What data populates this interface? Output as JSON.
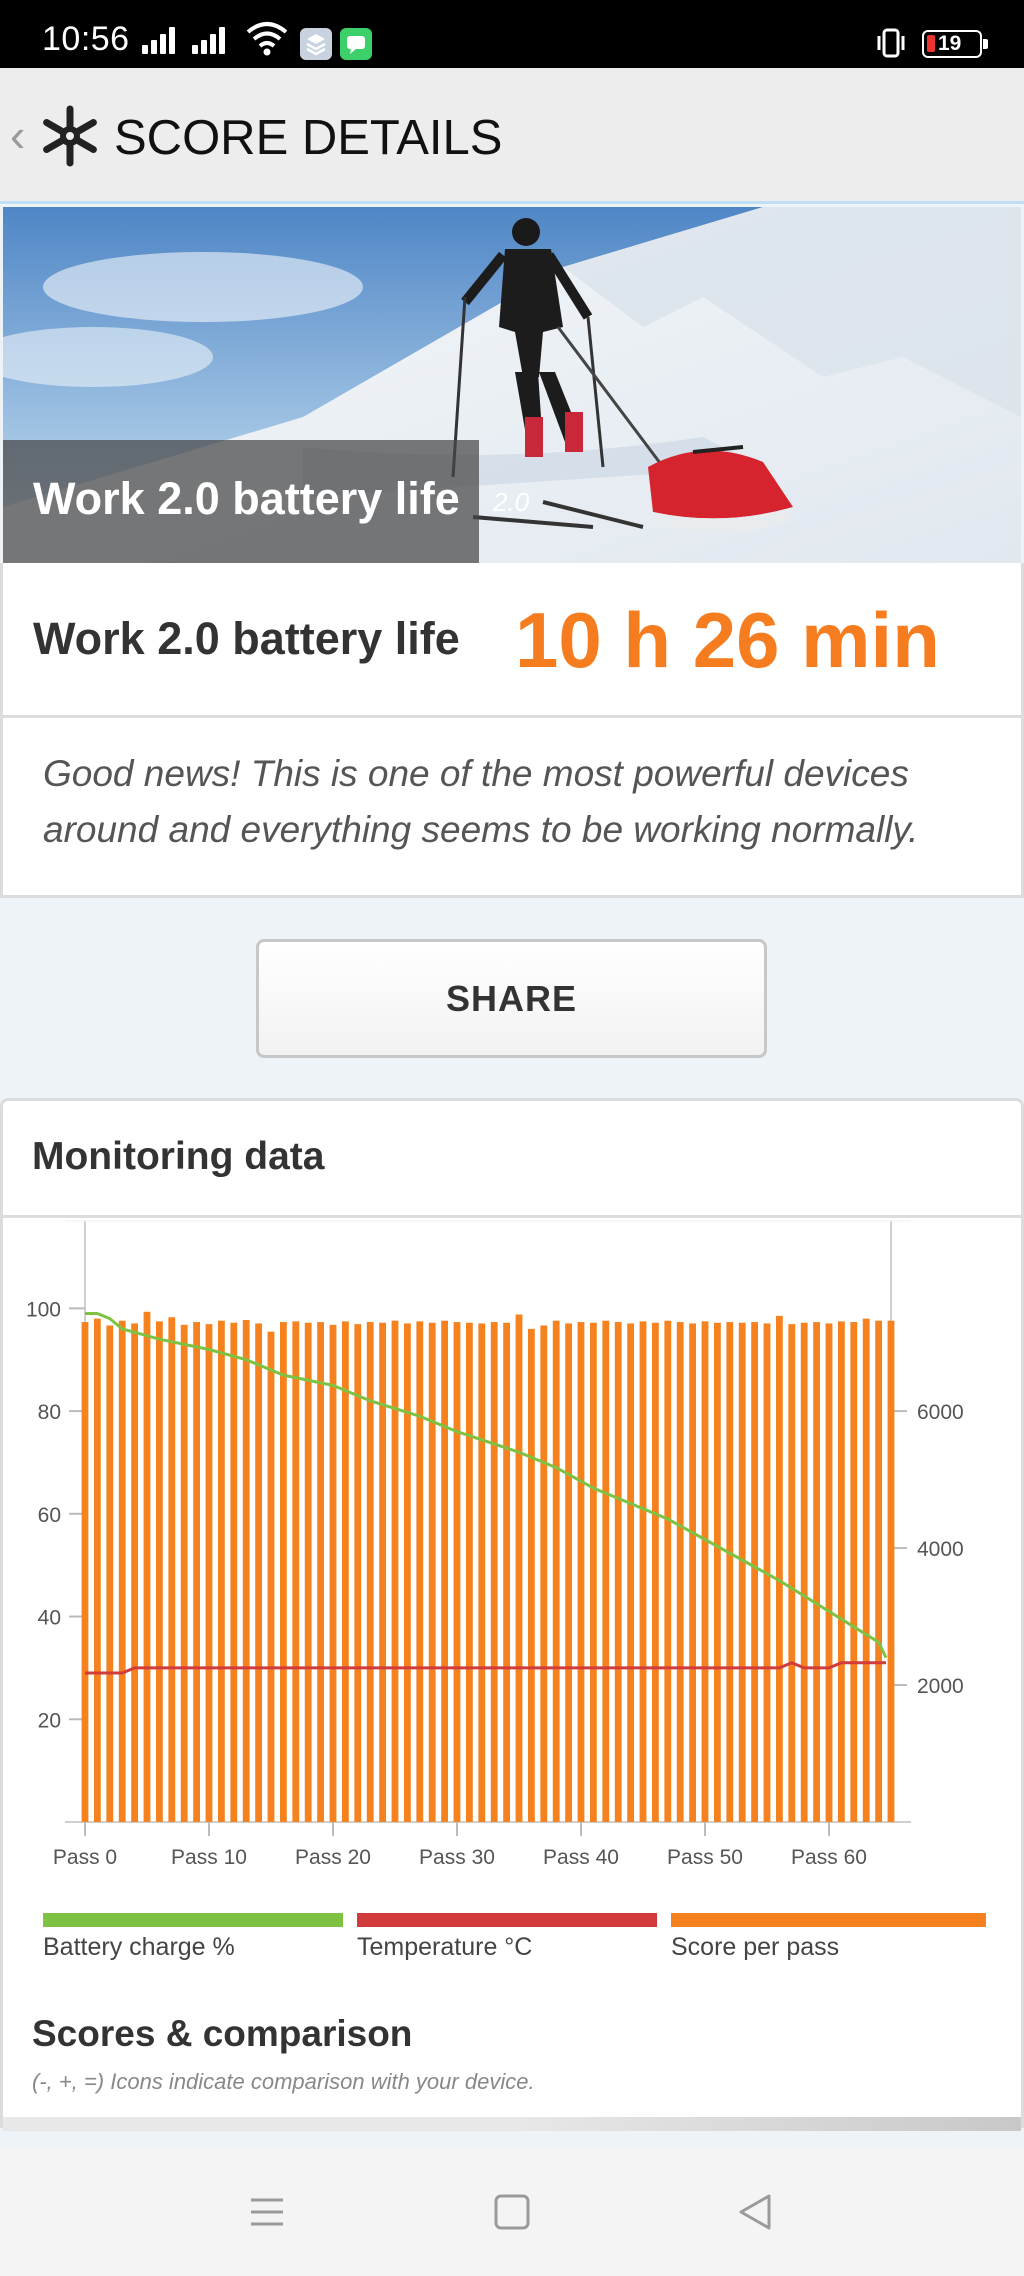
{
  "status_bar": {
    "time": "10:56",
    "battery_level": "19",
    "icons": [
      "signal-icon",
      "signal-icon",
      "wifi-icon",
      "stack-app-icon",
      "message-app-icon",
      "vibrate-icon",
      "battery-icon"
    ]
  },
  "app_bar": {
    "back_glyph": "‹",
    "title": "SCORE DETAILS",
    "logo_icon": "snowflake-icon"
  },
  "hero": {
    "title": "Work 2.0 battery life",
    "version": "2.0"
  },
  "result": {
    "label": "Work 2.0 battery life",
    "value": "10 h 26 min",
    "message": "Good news! This is one of the most powerful devices around and everything seems to be working normally."
  },
  "share_button": {
    "label": "SHARE"
  },
  "monitoring": {
    "title": "Monitoring data",
    "legend": [
      {
        "label": "Battery charge %",
        "color": "#7dc242"
      },
      {
        "label": "Temperature °C",
        "color": "#d13b3b"
      },
      {
        "label": "Score per pass",
        "color": "#f5821f"
      }
    ]
  },
  "scores": {
    "title": "Scores & comparison",
    "subtitle": "(-, +, =) Icons indicate comparison with your device."
  },
  "chart_data": {
    "type": "bar",
    "left_axis": {
      "ticks": [
        "100",
        "80",
        "60",
        "40",
        "20"
      ],
      "range": [
        0,
        110
      ]
    },
    "right_axis": {
      "ticks": [
        "6000",
        "4000",
        "2000"
      ],
      "range": [
        0,
        8250
      ]
    },
    "x_ticks": [
      "Pass 0",
      "Pass 10",
      "Pass 20",
      "Pass 30",
      "Pass 40",
      "Pass 50",
      "Pass 60"
    ],
    "x_range": [
      0,
      65
    ],
    "series": [
      {
        "name": "Score per pass",
        "axis": "right",
        "color": "#f5821f",
        "values": [
          7300,
          7350,
          7250,
          7320,
          7280,
          7450,
          7310,
          7370,
          7260,
          7300,
          7270,
          7320,
          7290,
          7330,
          7280,
          7160,
          7300,
          7310,
          7290,
          7300,
          7260,
          7310,
          7270,
          7300,
          7290,
          7320,
          7280,
          7310,
          7290,
          7320,
          7300,
          7290,
          7280,
          7300,
          7290,
          7410,
          7200,
          7250,
          7320,
          7280,
          7300,
          7290,
          7320,
          7300,
          7280,
          7310,
          7290,
          7320,
          7300,
          7280,
          7310,
          7290,
          7300,
          7290,
          7300,
          7280,
          7390,
          7270,
          7290,
          7300,
          7280,
          7310,
          7300,
          7350,
          7320,
          7320
        ]
      },
      {
        "name": "Battery charge %",
        "axis": "left",
        "color": "#7dc242",
        "points": [
          [
            0,
            99
          ],
          [
            1,
            99
          ],
          [
            2,
            98
          ],
          [
            3,
            96
          ],
          [
            6,
            94
          ],
          [
            10,
            92
          ],
          [
            13,
            90
          ],
          [
            16,
            87
          ],
          [
            20,
            85
          ],
          [
            23,
            82
          ],
          [
            27,
            79
          ],
          [
            30,
            76
          ],
          [
            35,
            72
          ],
          [
            38,
            69
          ],
          [
            41,
            65
          ],
          [
            44,
            62
          ],
          [
            47,
            59
          ],
          [
            50,
            55
          ],
          [
            53,
            51
          ],
          [
            56,
            47
          ],
          [
            58,
            44
          ],
          [
            60,
            41
          ],
          [
            62,
            38
          ],
          [
            64,
            35
          ],
          [
            64.6,
            32
          ]
        ]
      },
      {
        "name": "Temperature °C",
        "axis": "left",
        "color": "#d13b3b",
        "points": [
          [
            0,
            29
          ],
          [
            3,
            29
          ],
          [
            4,
            30
          ],
          [
            56,
            30
          ],
          [
            57,
            31
          ],
          [
            58,
            30
          ],
          [
            60,
            30
          ],
          [
            61,
            31
          ],
          [
            64.6,
            31
          ]
        ]
      }
    ]
  }
}
